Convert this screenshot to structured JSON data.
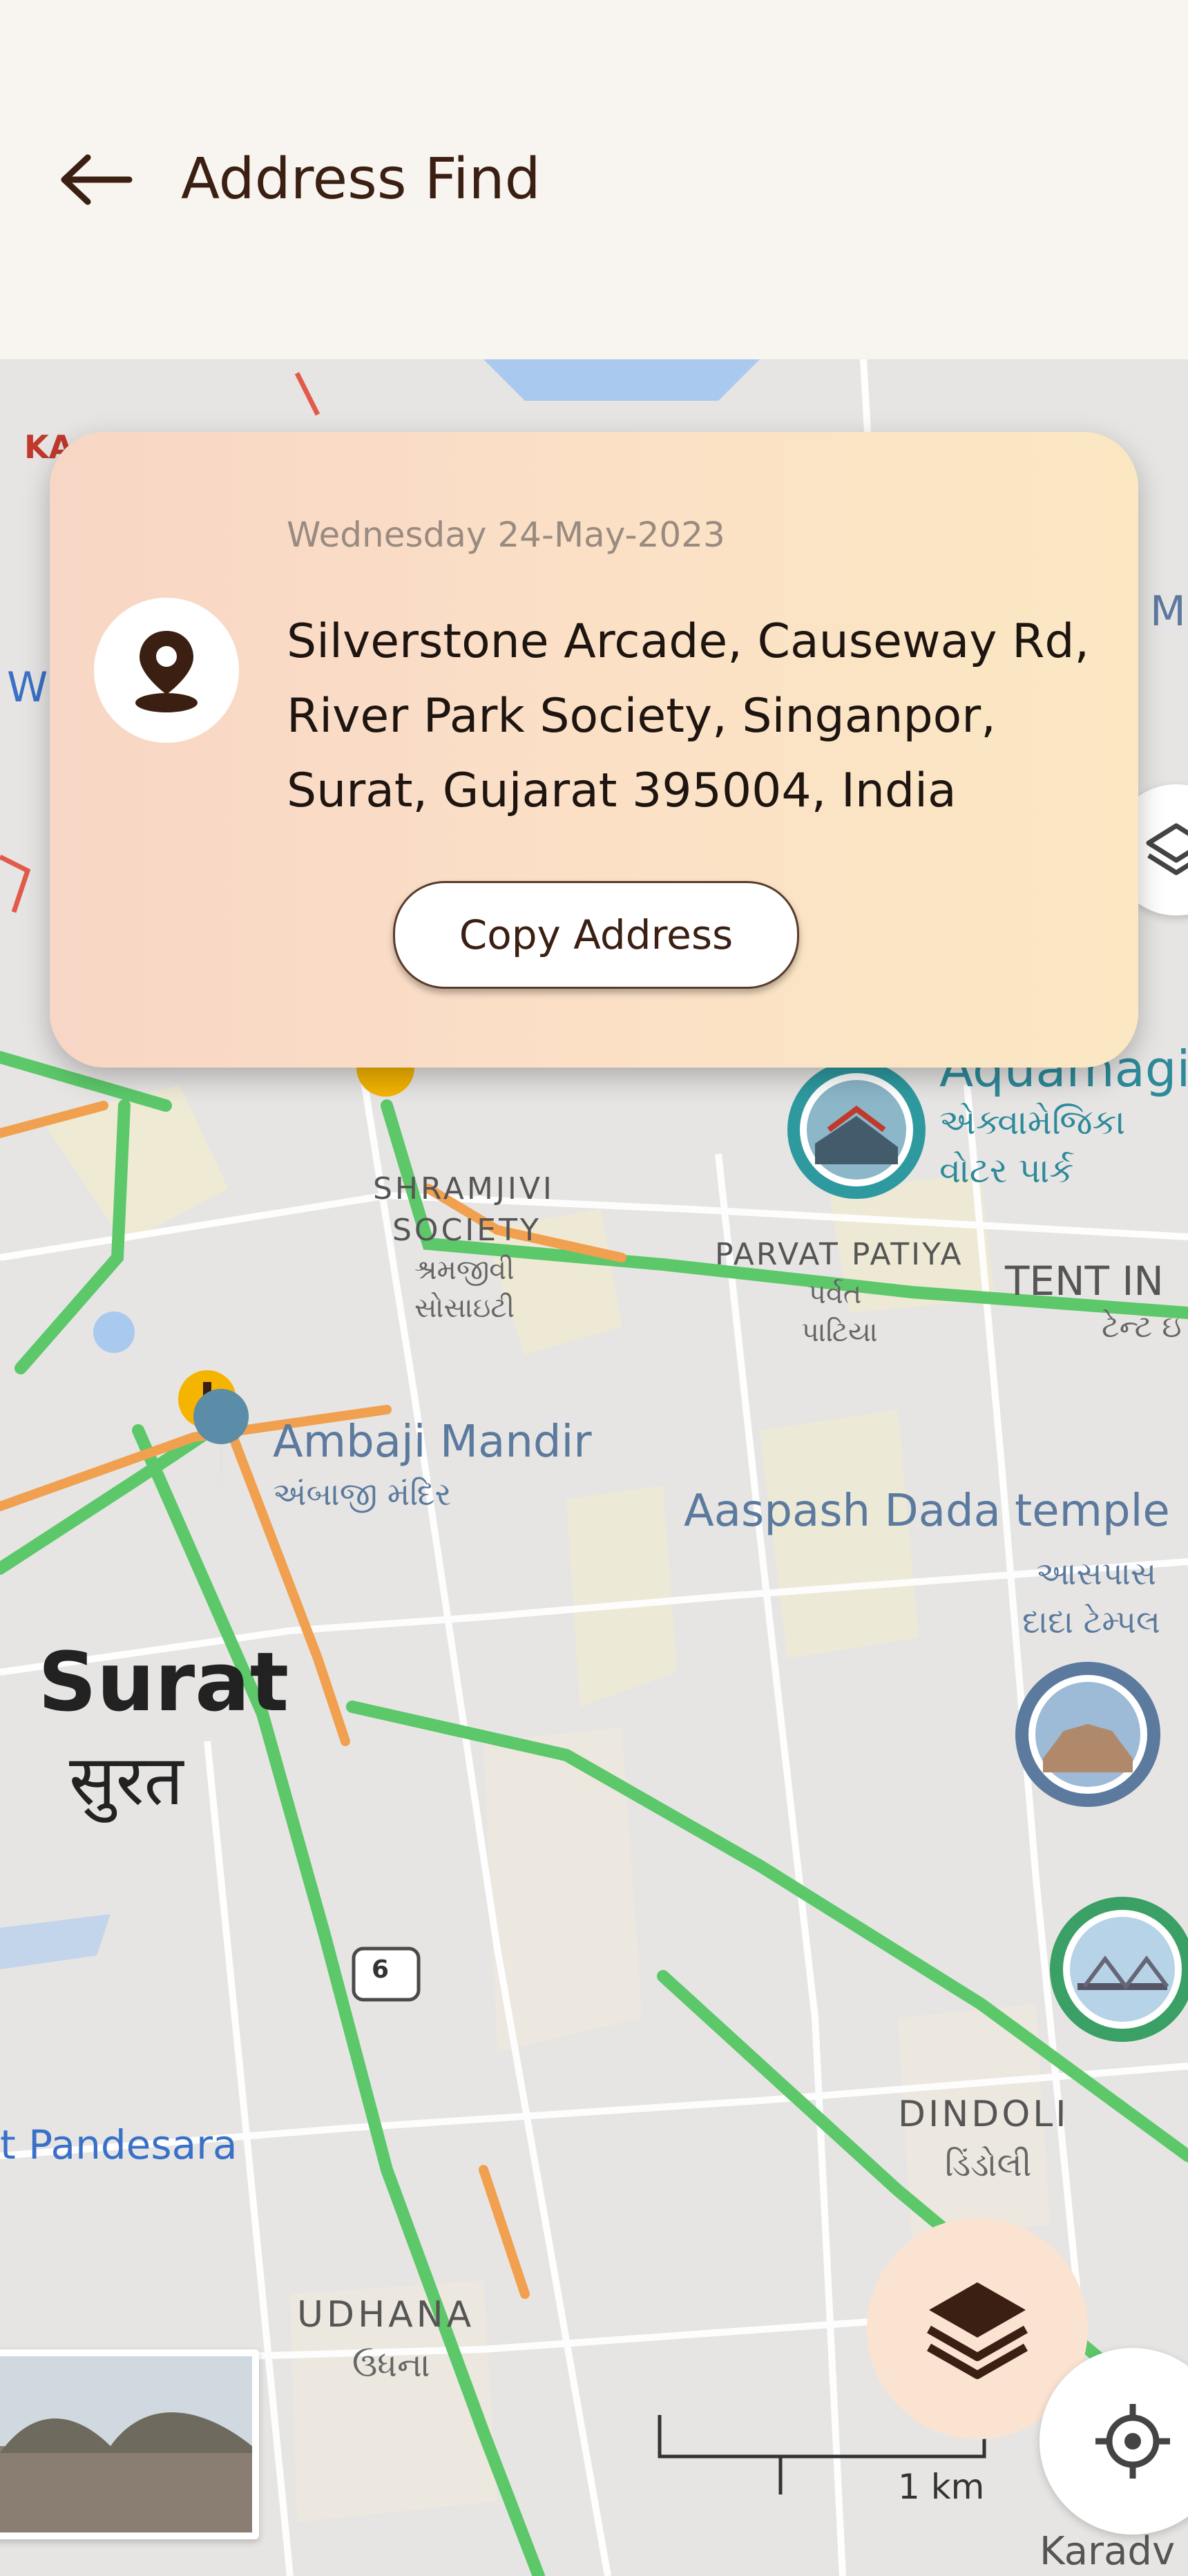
{
  "app_bar": {
    "title": "Address Find",
    "back_icon": "arrow-left-icon"
  },
  "card": {
    "date": "Wednesday 24-May-2023",
    "address_lines": [
      "Silverstone Arcade, Causeway Rd,",
      "River Park Society, Singanpor,",
      "Surat, Gujarat 395004, India"
    ],
    "copy_button_label": "Copy Address",
    "pin_icon": "location-pin-icon"
  },
  "map": {
    "labels": {
      "city": "Surat",
      "city_local": "सुरत",
      "shramjivi_1": "SHRAMJIVI",
      "shramjivi_2": "SOCIETY",
      "shramjivi_local_1": "શ્રમજીવી",
      "shramjivi_local_2": "સોસાઇટી",
      "parvat_patiya": "PARVAT PATIYA",
      "parvat_local_1": "પર્વત",
      "parvat_local_2": "પાટિયા",
      "ambaji": "Ambaji Mandir",
      "ambaji_local": "અંબાજી મંદિર",
      "aaspash": "Aaspash Dada temple",
      "aaspash_local_1": "આસપાસ",
      "aaspash_local_2": "દાદા ટેમ્પલ",
      "aquamagic": "Aquamagic",
      "aquamagic_local_1": "એક્વામેજિકા",
      "aquamagic_local_2": "વોટર પાર્ક",
      "tent": "TENT IN",
      "tent_local": "ટેન્ટ ઇ",
      "dindoli": "DINDOLI",
      "dindoli_local": "ડિંડોલી",
      "udhana": "UDHANA",
      "udhana_local": "ઉધના",
      "pandesara": "t Pandesara",
      "karadva": "Karadv",
      "route_6": "6",
      "ka": "KA",
      "w": "W",
      "m": "M"
    },
    "scale_label": "1 km",
    "colors": {
      "road_green": "#5cc86a",
      "road_orange": "#f0a04e",
      "road_red": "#e25a4a",
      "water": "#aac9ef",
      "land": "#e7e5e2"
    }
  },
  "controls": {
    "layers_fab_icon": "layers-icon",
    "locate_icon": "crosshair-locate-icon",
    "map_layers_icon": "layers-icon"
  },
  "colors": {
    "primary_brown": "#3a1f12",
    "card_gradient_start": "#f8d6c5",
    "card_gradient_end": "#fbe8c3",
    "background": "#f8f4f0"
  }
}
